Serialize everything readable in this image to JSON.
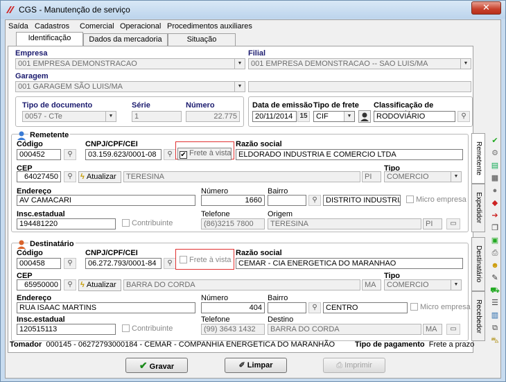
{
  "window": {
    "title": "CGS - Manutenção de serviço",
    "close": "✕"
  },
  "menu": [
    "Saída",
    "Cadastros",
    "Comercial",
    "Operacional",
    "Procedimentos auxiliares"
  ],
  "tabs": [
    "Identificação",
    "Dados da mercadoria",
    "Situação"
  ],
  "header": {
    "empresa_label": "Empresa",
    "empresa_value": "001 EMPRESA DEMONSTRACAO",
    "filial_label": "Filial",
    "filial_value": "001 EMPRESA DEMONSTRACAO -- SAO LUIS/MA",
    "garagem_label": "Garagem",
    "garagem_value": "001 GARAGEM SÃO LUIS/MA",
    "tipo_doc_label": "Tipo de documento",
    "tipo_doc_value": "0057 - CTe",
    "serie_label": "Série",
    "serie_value": "1",
    "numero_label": "Número",
    "numero_value": "22.775",
    "data_emissao_label": "Data de emissão",
    "data_emissao_value": "20/11/2014",
    "tipo_frete_label": "Tipo de frete",
    "tipo_frete_value": "CIF",
    "classificacao_label": "Classificação de transporte",
    "classificacao_value": "RODOVIÁRIO",
    "calendar": "15"
  },
  "remetente": {
    "title": "Remetente",
    "codigo_label": "Código",
    "codigo": "000452",
    "cnpj_label": "CNPJ/CPF/CEI",
    "cnpj": "03.159.623/0001-08",
    "frete_vista": "Frete à vista",
    "razao_label": "Razão social",
    "razao": "ELDORADO INDUSTRIA E COMERCIO LTDA",
    "cep_label": "CEP",
    "cep": "64027450",
    "atualizar": "Atualizar",
    "cidade": "TERESINA",
    "uf": "PI",
    "tipo_label": "Tipo",
    "tipo": "COMERCIO",
    "endereco_label": "Endereço",
    "endereco": "AV CAMACARI",
    "numero_label": "Número",
    "numero": "1660",
    "bairro_label": "Bairro",
    "bairro": "DISTRITO INDUSTRIAL",
    "micro": "Micro empresa",
    "insc_label": "Insc.estadual",
    "insc": "194481220",
    "contribuinte": "Contribuinte",
    "telefone_label": "Telefone",
    "telefone": "(86)3215 7800",
    "origem_label": "Origem",
    "origem": "TERESINA",
    "origem_uf": "PI"
  },
  "destinatario": {
    "title": "Destinatário",
    "codigo_label": "Código",
    "codigo": "000458",
    "cnpj_label": "CNPJ/CPF/CEI",
    "cnpj": "06.272.793/0001-84",
    "frete_vista": "Frete à vista",
    "razao_label": "Razão social",
    "razao": "CEMAR - CIA ENERGETICA DO MARANHAO",
    "cep_label": "CEP",
    "cep": "65950000",
    "atualizar": "Atualizar",
    "cidade": "BARRA DO CORDA",
    "uf": "MA",
    "tipo_label": "Tipo",
    "tipo": "COMERCIO",
    "endereco_label": "Endereço",
    "endereco": "RUA ISAAC MARTINS",
    "numero_label": "Número",
    "numero": "404",
    "bairro_label": "Bairro",
    "bairro": "CENTRO",
    "micro": "Micro empresa",
    "insc_label": "Insc.estadual",
    "insc": "120515113",
    "contribuinte": "Contribuinte",
    "telefone_label": "Telefone",
    "telefone": "(99) 3643 1432",
    "destino_label": "Destino",
    "destino": "BARRA DO CORDA",
    "destino_uf": "MA"
  },
  "side_tabs": [
    "Remetente",
    "Expedidor",
    "Destinatário",
    "Recebedor"
  ],
  "footer": {
    "tomador_label": "Tomador",
    "tomador": "000145 - 06272793000184 - CEMAR - COMPANHIA ENERGETICA DO MARANHÃO",
    "pagamento_label": "Tipo de pagamento",
    "pagamento": "Frete a prazo"
  },
  "buttons": {
    "gravar": "Gravar",
    "limpar": "Limpar",
    "imprimir": "Imprimir"
  },
  "colors": {
    "label_blue": "#1a1a6e",
    "highlight_red": "#e03030",
    "title_bar": "#c7dbef"
  }
}
